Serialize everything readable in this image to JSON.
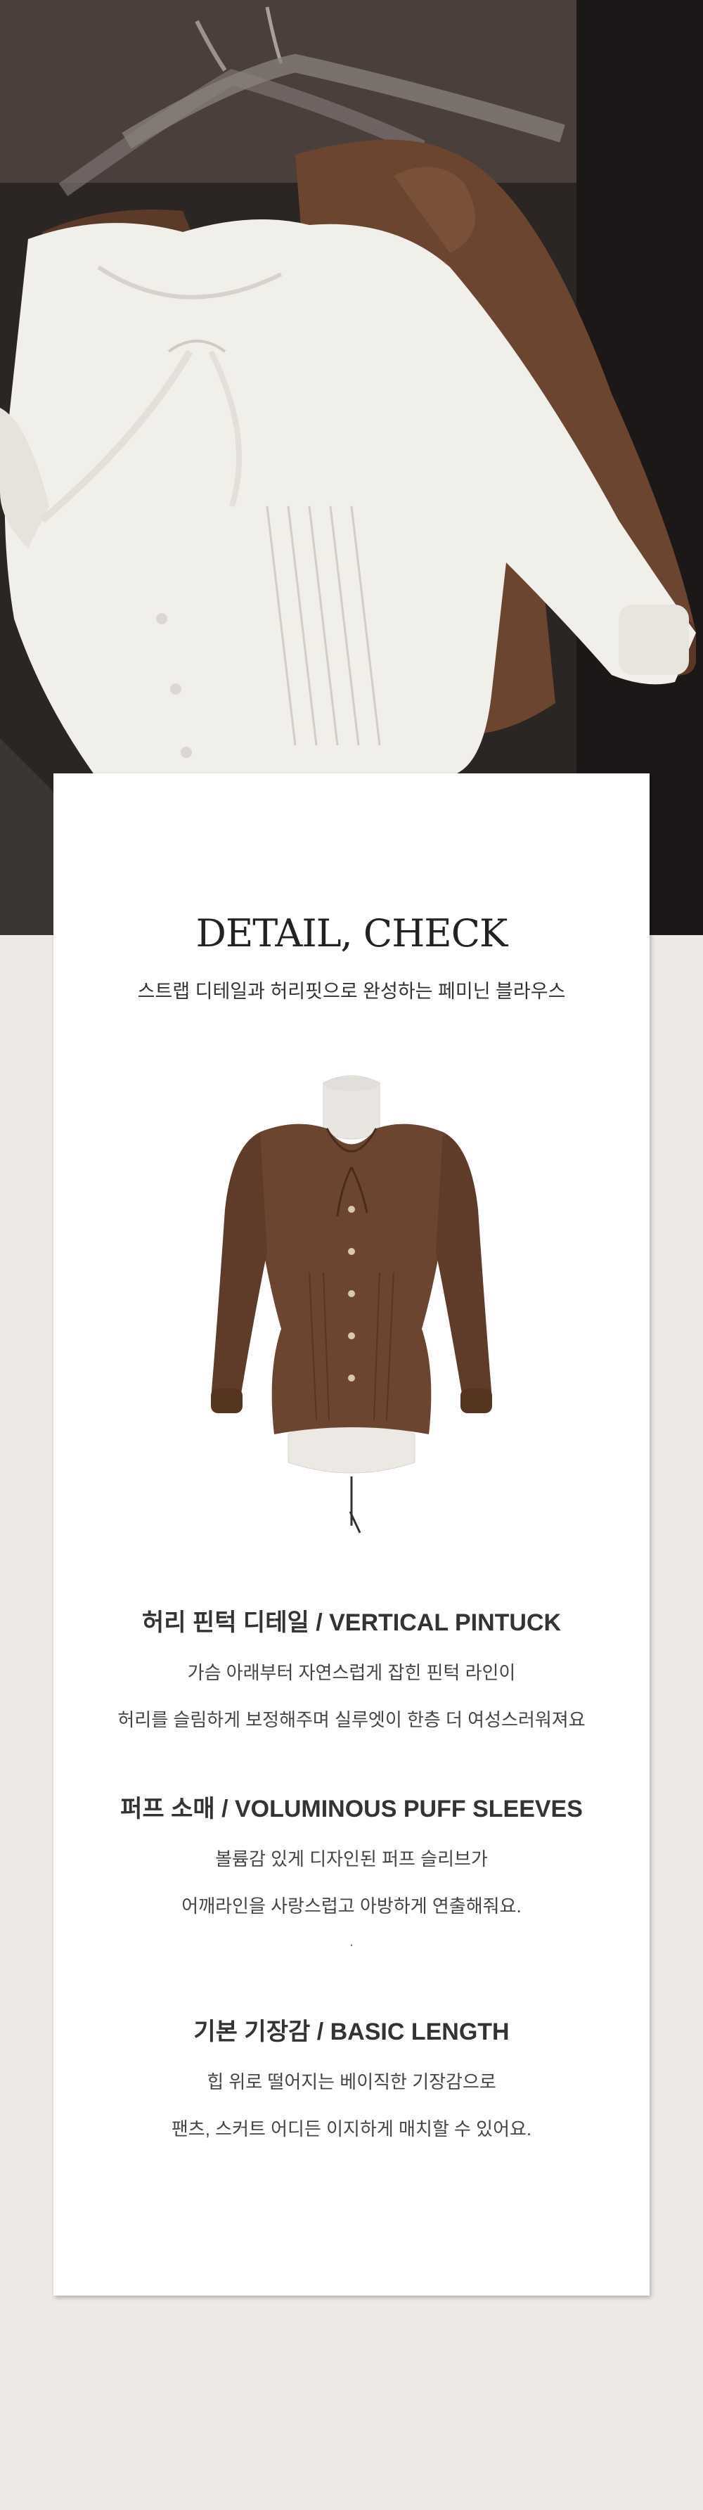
{
  "card": {
    "title": "DETAIL, CHECK",
    "subtitle": "스트랩 디테일과 허리핏으로 완성하는 페미닌 블라우스"
  },
  "features": [
    {
      "heading": "허리 핀턱 디테일 / VERTICAL PINTUCK",
      "lines": [
        "가슴 아래부터 자연스럽게 잡힌 핀턱 라인이",
        "허리를 슬림하게 보정해주며 실루엣이 한층 더 여성스러워져요"
      ]
    },
    {
      "heading": "퍼프 소매 / VOLUMINOUS PUFF SLEEVES",
      "lines": [
        "볼륨감 있게 디자인된 퍼프 슬리브가",
        "어깨라인을 사랑스럽고 아방하게 연출해줘요."
      ]
    },
    {
      "heading": "기본 기장감 / BASIC LENGTH",
      "lines": [
        "힙 위로 떨어지는 베이직한 기장감으로",
        "팬츠, 스커트 어디든 이지하게 매치할 수 있어요."
      ]
    }
  ],
  "separator": ".",
  "colors": {
    "background": "#edeae5",
    "blouse_white": "#f1efea",
    "blouse_brown": "#6b4530"
  }
}
